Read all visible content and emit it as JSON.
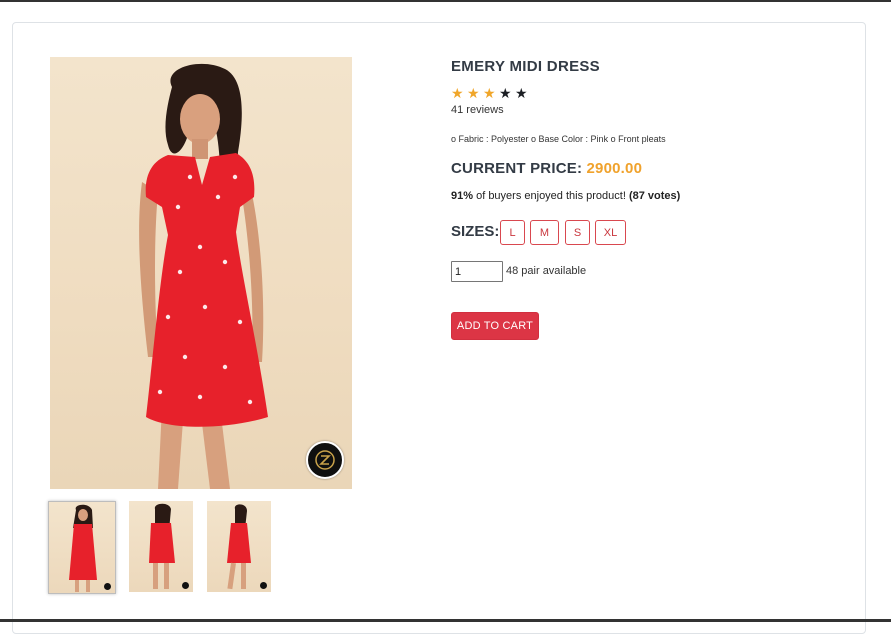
{
  "product": {
    "title": "EMERY MIDI DRESS",
    "rating": {
      "value": 3,
      "max": 5
    },
    "reviews_text": "41 reviews",
    "specs_text": "o Fabric : Polyester o Base Color : Pink o Front pleats",
    "price_label": "CURRENT PRICE:",
    "price_value": "2900.00",
    "vote_percent": "91%",
    "vote_text": " of buyers enjoyed this product! ",
    "vote_count": "(87 votes)",
    "sizes_label": "SIZES:",
    "sizes": [
      "L",
      "M",
      "S",
      "XL"
    ],
    "quantity_value": "1",
    "availability_text": "48 pair available",
    "add_to_cart_label": "ADD TO CART"
  },
  "gallery": {
    "main_image": "woman-in-red-dress-front",
    "thumbnails": [
      "dress-front-view",
      "dress-back-view",
      "dress-side-view"
    ],
    "active_thumbnail": 0,
    "badge_icon": "brand-logo-icon"
  },
  "colors": {
    "accent_price": "#f0a22c",
    "star_on": "#f0a62a",
    "star_off": "#1c1f24",
    "cart_button": "#dc3545",
    "size_border": "#d9484f"
  }
}
